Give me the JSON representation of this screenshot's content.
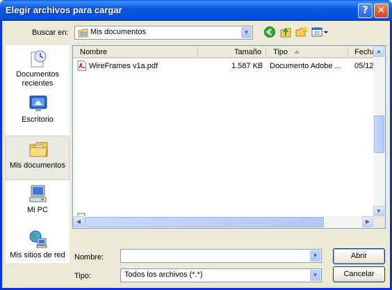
{
  "window": {
    "title": "Elegir archivos para cargar",
    "help": "?",
    "close": "✕"
  },
  "toolbar": {
    "look_in_label": "Buscar en:",
    "look_in_value": "Mis documentos",
    "icons": [
      "back-icon",
      "up-folder-icon",
      "new-folder-icon",
      "views-menu-icon"
    ]
  },
  "places": [
    {
      "label": "Documentos recientes",
      "icon": "recent-documents-icon"
    },
    {
      "label": "Escritorio",
      "icon": "desktop-icon"
    },
    {
      "label": "Mis documentos",
      "icon": "my-documents-icon",
      "active": true
    },
    {
      "label": "Mi PC",
      "icon": "my-computer-icon"
    },
    {
      "label": "Mis sitios de red",
      "icon": "network-places-icon"
    }
  ],
  "columns": {
    "name": "Nombre",
    "size": "Tamaño",
    "type": "Tipo",
    "date": "Fecha"
  },
  "files": [
    {
      "name": "WireFrames v1a.pdf",
      "size": "1.587 KB",
      "type": "Documento Adobe ...",
      "date": "05/12"
    }
  ],
  "form": {
    "name_label": "Nombre:",
    "name_value": "",
    "type_label": "Tipo:",
    "type_value": "Todos los archivos (*.*)"
  },
  "buttons": {
    "open": "Abrir",
    "cancel": "Cancelar"
  },
  "colors": {
    "titlebar": "#0a58e0",
    "dialog_bg": "#ece9d8",
    "close": "#d1441f"
  }
}
